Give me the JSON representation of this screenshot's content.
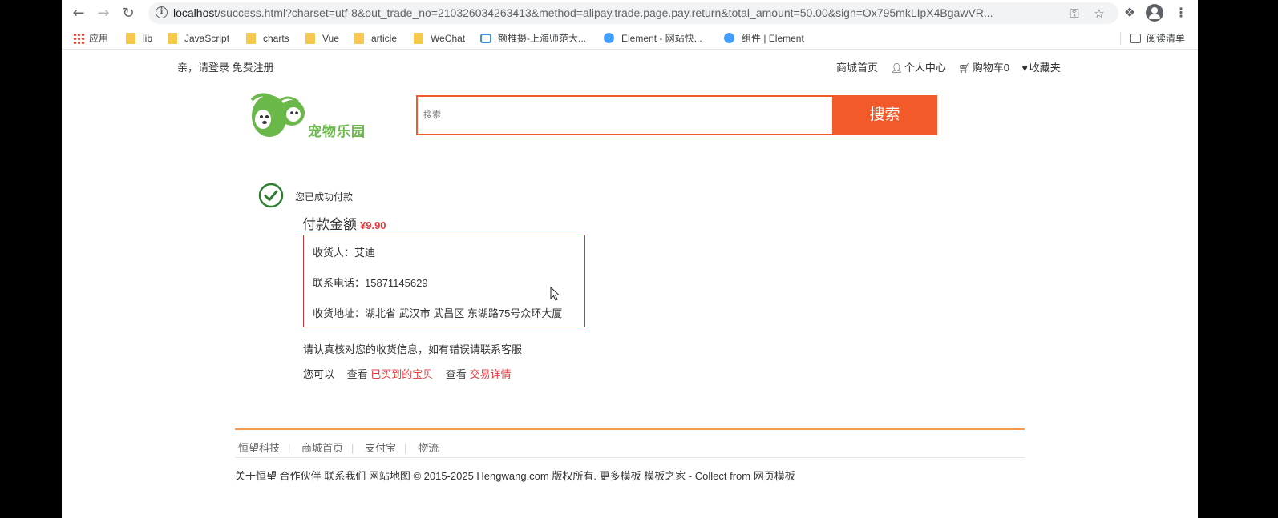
{
  "browser": {
    "url_host": "localhost",
    "url_rest": "/success.html?charset=utf-8&out_trade_no=210326034263413&method=alipay.trade.page.pay.return&total_amount=50.00&sign=Ox795mkLIpX4BgawVR...",
    "icons": {
      "back": "arrow-left-icon",
      "forward": "arrow-right-icon",
      "reload": "reload-icon",
      "info": "info-icon",
      "key": "key-icon",
      "star": "star-icon",
      "extensions": "puzzle-icon",
      "profile": "profile-icon",
      "menu": "kebab-menu-icon"
    }
  },
  "bookmarks": {
    "apps": "应用",
    "items": [
      "lib",
      "JavaScript",
      "charts",
      "Vue",
      "article",
      "WeChat"
    ],
    "bili": "额椎摄-上海师范大...",
    "element1": "Element - 网站快...",
    "element2": "组件 | Element",
    "reading_list": "阅读清单"
  },
  "header": {
    "greeting": "亲，请登录",
    "register": "免费注册",
    "links": {
      "home": "商城首页",
      "profile": "个人中心",
      "cart": "购物车0",
      "favorites": "收藏夹"
    }
  },
  "logo": {
    "text": "宠物乐园"
  },
  "search": {
    "placeholder": "搜索",
    "button": "搜索"
  },
  "success": {
    "message": "您已成功付款",
    "amount_label": "付款金额",
    "amount": "¥9.90"
  },
  "receiver": {
    "name_line": "收货人：艾迪",
    "phone_line": "联系电话：15871145629",
    "address_line": "收货地址：湖北省 武汉市 武昌区 东湖路75号众环大厦"
  },
  "note": "请认真核对您的收货信息，如有错误请联系客服",
  "links_line": {
    "prefix": "您可以",
    "view1": "查看",
    "bought": "已买到的宝贝",
    "view2": "查看",
    "details": "交易详情"
  },
  "footer": {
    "links": [
      "恒望科技",
      "商城首页",
      "支付宝",
      "物流"
    ],
    "copyright": "关于恒望 合作伙伴 联系我们 网站地图 © 2015-2025 Hengwang.com 版权所有. 更多模板 模板之家 - Collect from 网页模板"
  },
  "colors": {
    "accent": "#f25a29",
    "price": "#e4393c",
    "logo_green": "#6bb84a",
    "success_green": "#2e7d32",
    "footer_line": "#f29b4c"
  }
}
